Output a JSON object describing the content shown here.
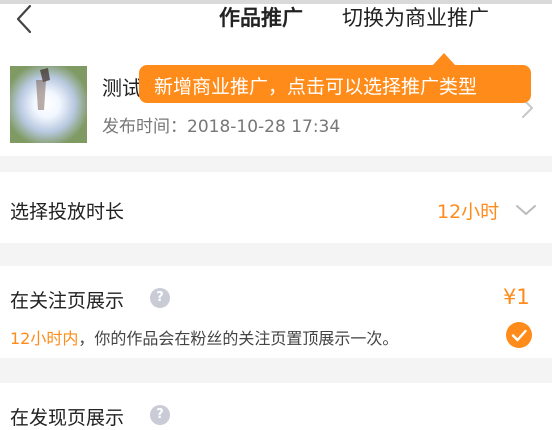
{
  "header": {
    "title": "作品推广",
    "switch_label": "切换为商业推广"
  },
  "work": {
    "title": "测试",
    "publish_time": "发布时间：2018-10-28 17:34"
  },
  "tooltip": {
    "text": "新增商业推广，点击可以选择推广类型"
  },
  "duration": {
    "label": "选择投放时长",
    "value": "12小时"
  },
  "options": [
    {
      "label": "在关注页展示",
      "price": "¥1",
      "desc_highlight": "12小时内",
      "desc_rest": "，你的作品会在粉丝的关注页置顶展示一次。",
      "selected": true
    },
    {
      "label": "在发现页展示"
    }
  ],
  "colors": {
    "accent": "#ff8c1a",
    "help": "#c9ccd6",
    "separator": "#f4f4f4"
  },
  "icons": [
    "back-icon",
    "chevron-right-icon",
    "chevron-down-icon",
    "help-icon",
    "check-icon"
  ]
}
